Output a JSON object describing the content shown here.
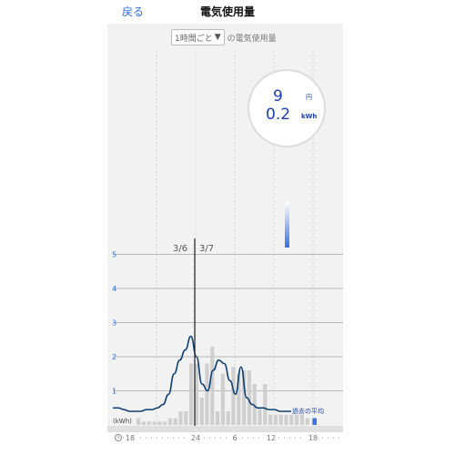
{
  "header": {
    "back_label": "戻る",
    "title": "電気使用量"
  },
  "selector": {
    "value": "1時間ごと",
    "arrow": "▼",
    "suffix": "の電気使用量"
  },
  "summary": {
    "yen_value": "9",
    "yen_unit": "円",
    "kwh_value": "0.2",
    "kwh_unit": "kWh"
  },
  "colors": {
    "accent": "#2f6fd6",
    "line": "#0d3f73",
    "bar": "#cfcfcf",
    "current_bar": "#3a6fe0",
    "panel": "#f2f2f2"
  },
  "icons": {
    "clock": "clock-icon"
  },
  "chart_data": {
    "type": "bar",
    "unit_label": "(kWh)",
    "yticks": [
      "1",
      "2",
      "3",
      "4",
      "5"
    ],
    "ylim": [
      0,
      5
    ],
    "date_labels": [
      "3/6",
      "3/7"
    ],
    "x_tick_labels": [
      "18",
      "24",
      "6",
      "12",
      "18"
    ],
    "bars": [
      0.2,
      0.1,
      0.1,
      0.1,
      0.1,
      0.1,
      0.2,
      0.2,
      0.4,
      0.4,
      1.8,
      1.8,
      0.8,
      1.8,
      2.3,
      0.4,
      1.5,
      0.4,
      1.7,
      1.5,
      1.6,
      1.6,
      1.2,
      0.5,
      1.2,
      0.3,
      0.3,
      0.3,
      0.3,
      0.3,
      0.3,
      0.3,
      0.2
    ],
    "current_bar_value": 0.2,
    "series": [
      {
        "name": "過去の平均",
        "values": [
          0.5,
          0.5,
          0.45,
          0.4,
          0.4,
          0.4,
          0.45,
          0.45,
          0.5,
          0.6,
          0.9,
          1.5,
          1.9,
          2.2,
          2.6,
          2.0,
          1.2,
          1.0,
          1.6,
          1.9,
          1.8,
          1.3,
          0.9,
          1.7,
          0.8,
          0.6,
          0.5,
          0.5,
          0.45,
          0.45,
          0.4,
          0.4,
          0.4
        ]
      }
    ],
    "current_level_indicator": 0.6
  }
}
